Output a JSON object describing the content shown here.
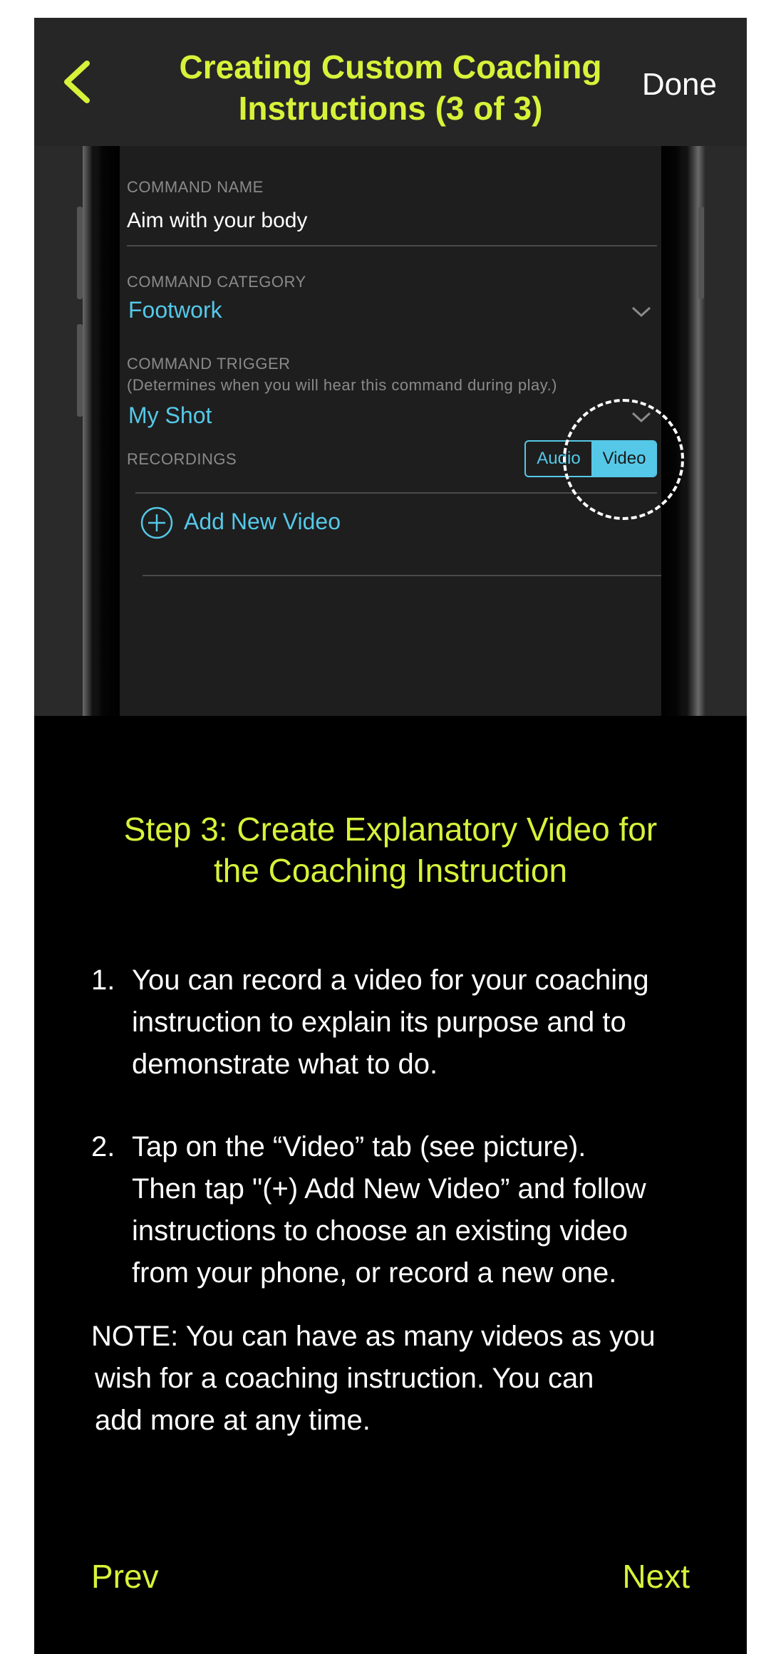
{
  "header": {
    "title_line1": "Creating Custom Coaching",
    "title_line2": "Instructions (3 of 3)",
    "done_label": "Done",
    "back_icon": "chevron-left-icon",
    "accent_color": "#d8f23a"
  },
  "phone_screen": {
    "command_name_label": "COMMAND NAME",
    "command_name_value": "Aim with your body",
    "command_category_label": "COMMAND CATEGORY",
    "command_category_value": "Footwork",
    "command_trigger_label": "COMMAND TRIGGER",
    "command_trigger_hint": "(Determines when you will hear this command during play.)",
    "command_trigger_value": "My Shot",
    "recordings_label": "RECORDINGS",
    "segment_audio": "Audio",
    "segment_video": "Video",
    "add_new_video_label": "Add New Video",
    "link_color": "#55c8e8"
  },
  "step": {
    "title_line1": "Step 3: Create Explanatory Video for",
    "title_line2": "the Coaching Instruction",
    "items": [
      {
        "number": "1.",
        "lines": [
          "You can record a video for your coaching",
          "instruction to explain its purpose and to",
          "demonstrate what to do."
        ]
      },
      {
        "number": "2.",
        "lines": [
          "Tap on the “Video” tab (see picture).",
          "Then tap \"(+) Add New Video” and follow",
          "instructions to choose an existing video",
          "from your phone, or record a new one."
        ]
      }
    ],
    "note_lines": [
      "NOTE:  You can have as many videos as you",
      "wish for a coaching instruction. You can",
      "add more at any time."
    ]
  },
  "footer": {
    "prev_label": "Prev",
    "next_label": "Next"
  }
}
